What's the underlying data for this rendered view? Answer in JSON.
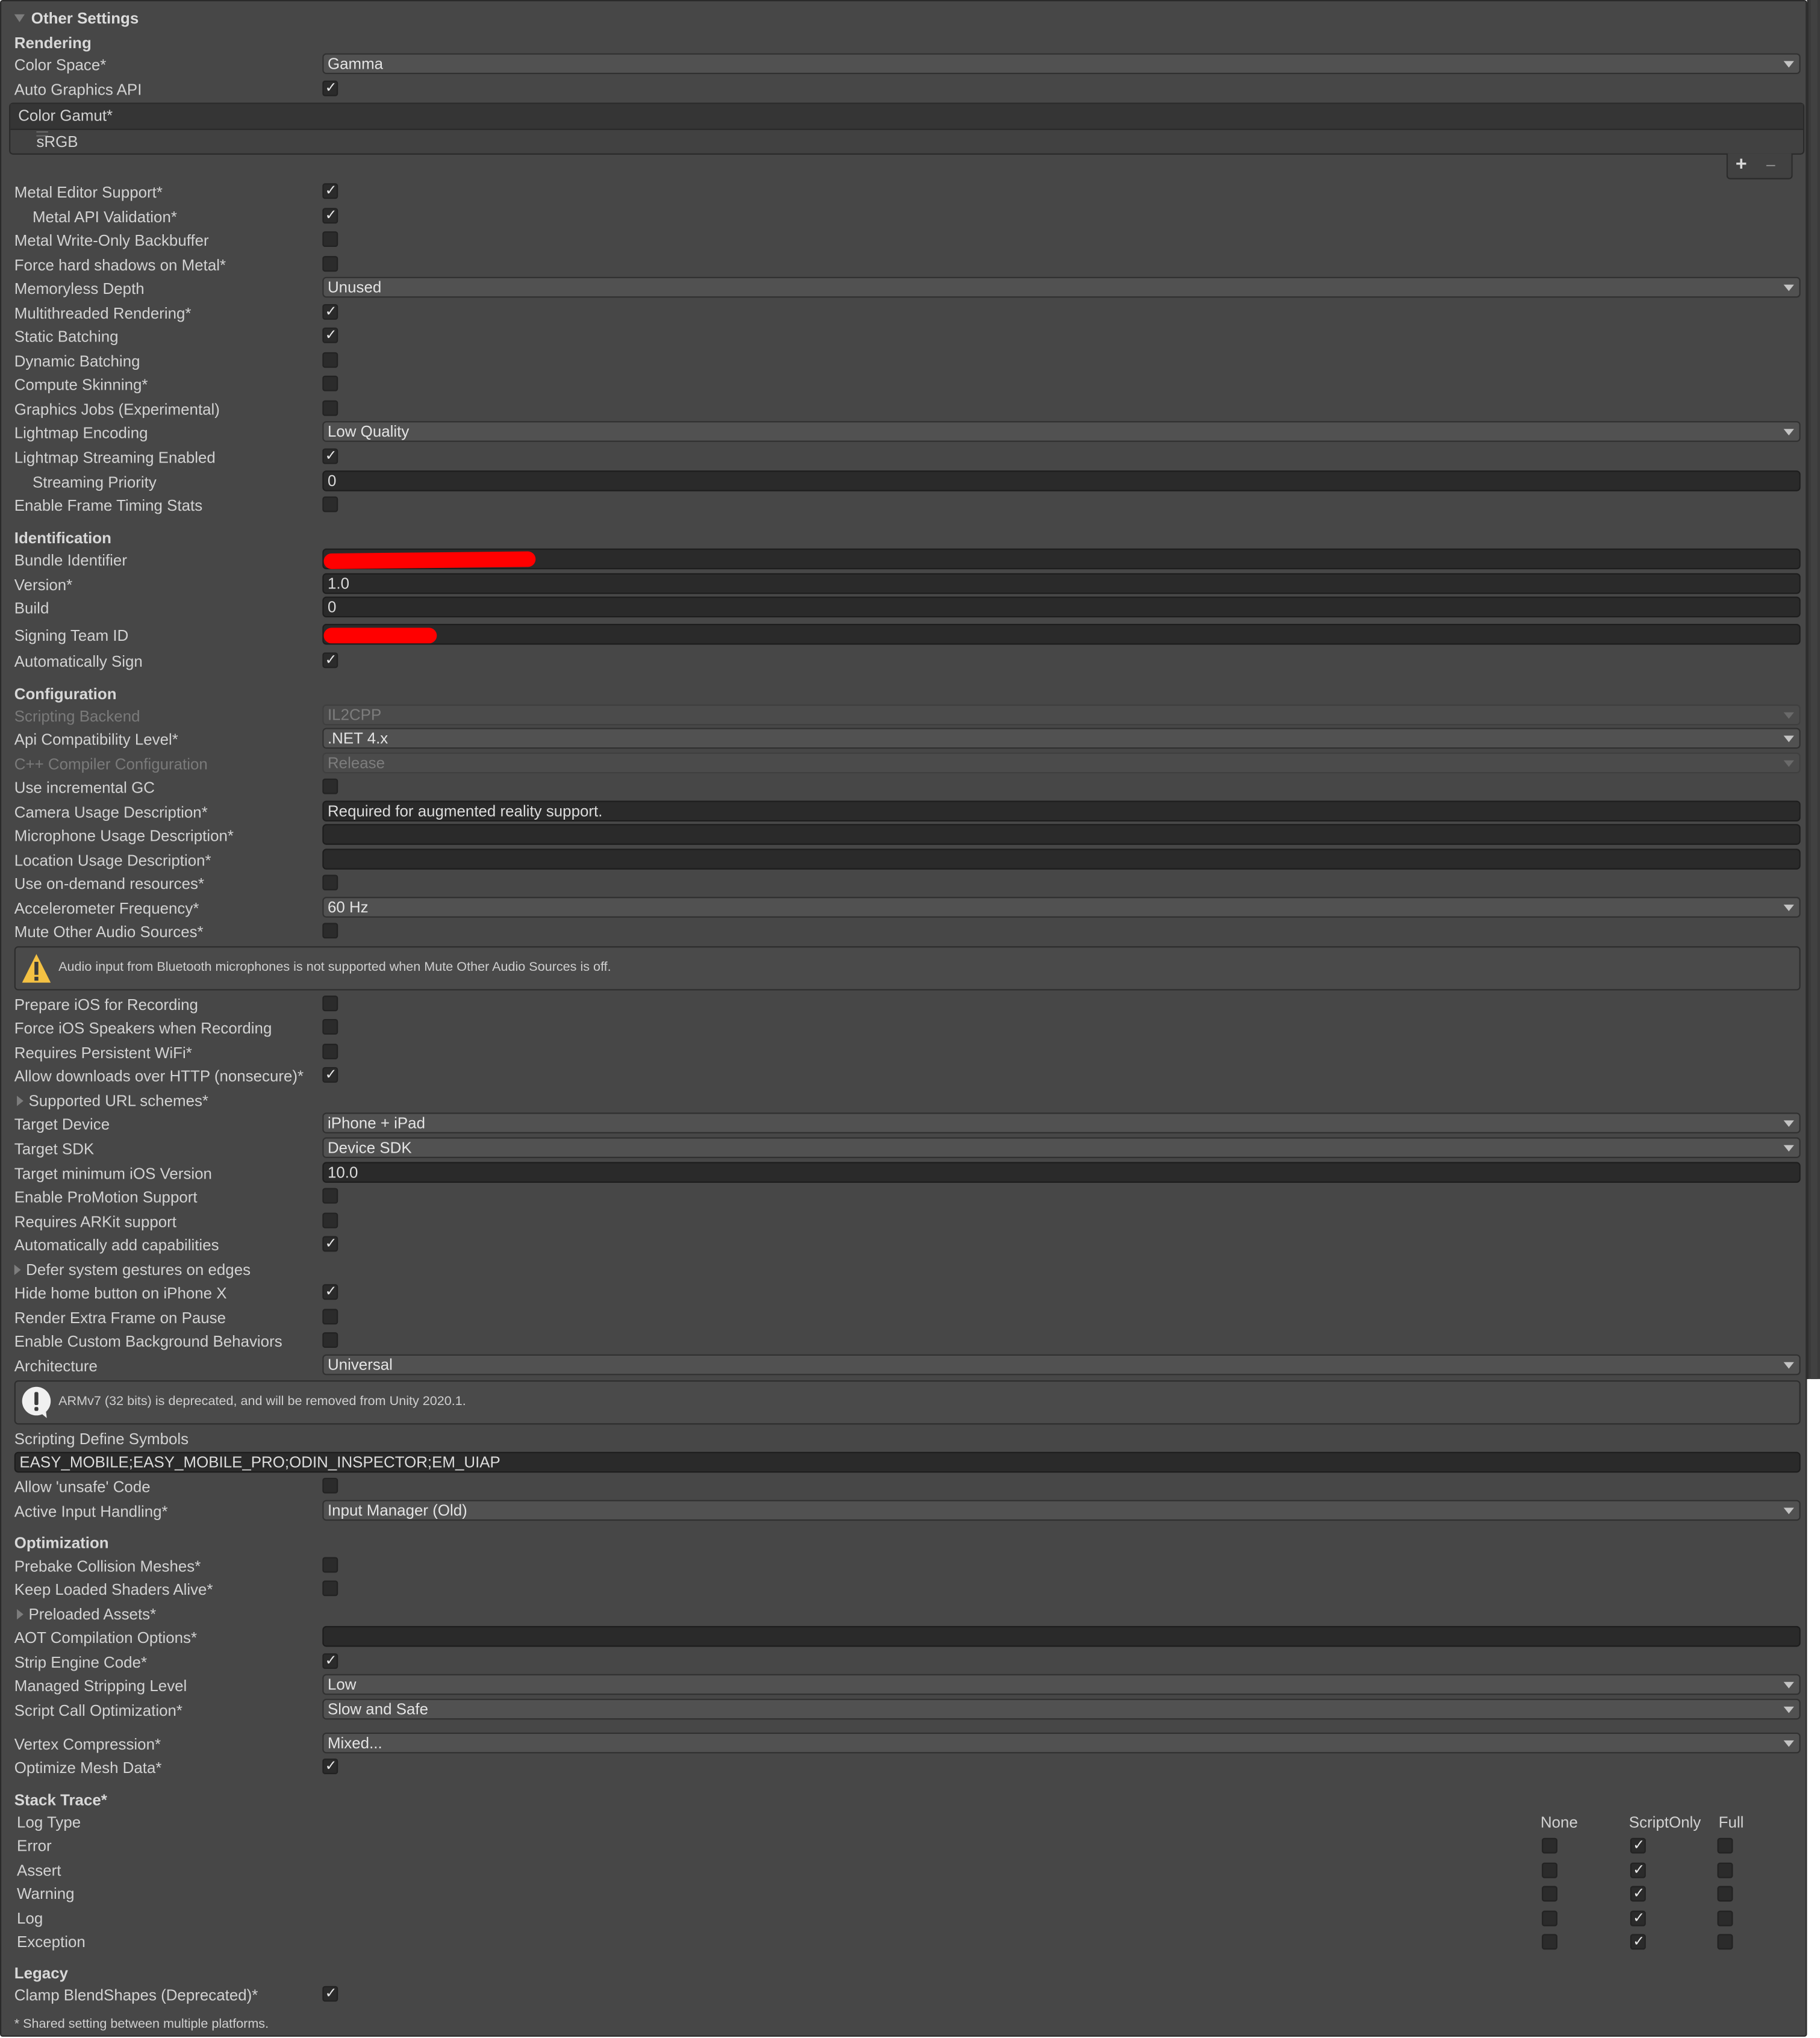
{
  "panel": {
    "title": "Other Settings",
    "footnote": "* Shared setting between multiple platforms."
  },
  "rendering": {
    "heading": "Rendering",
    "color_space": {
      "label": "Color Space*",
      "value": "Gamma"
    },
    "auto_graphics_api": {
      "label": "Auto Graphics API",
      "checked": true
    },
    "color_gamut": {
      "label": "Color Gamut*",
      "items": [
        "sRGB"
      ],
      "add_icon": "plus-icon",
      "remove_icon": "minus-icon"
    },
    "metal_editor_support": {
      "label": "Metal Editor Support*",
      "checked": true
    },
    "metal_api_validation": {
      "label": "Metal API Validation*",
      "checked": true
    },
    "metal_write_only_backbuffer": {
      "label": "Metal Write-Only Backbuffer",
      "checked": false
    },
    "force_hard_shadows": {
      "label": "Force hard shadows on Metal*",
      "checked": false
    },
    "memoryless_depth": {
      "label": "Memoryless Depth",
      "value": "Unused"
    },
    "multithreaded_rendering": {
      "label": "Multithreaded Rendering*",
      "checked": true
    },
    "static_batching": {
      "label": "Static Batching",
      "checked": true
    },
    "dynamic_batching": {
      "label": "Dynamic Batching",
      "checked": false
    },
    "compute_skinning": {
      "label": "Compute Skinning*",
      "checked": false
    },
    "graphics_jobs": {
      "label": "Graphics Jobs (Experimental)",
      "checked": false
    },
    "lightmap_encoding": {
      "label": "Lightmap Encoding",
      "value": "Low Quality"
    },
    "lightmap_streaming": {
      "label": "Lightmap Streaming Enabled",
      "checked": true
    },
    "streaming_priority": {
      "label": "Streaming Priority",
      "value": "0"
    },
    "frame_timing_stats": {
      "label": "Enable Frame Timing Stats",
      "checked": false
    }
  },
  "identification": {
    "heading": "Identification",
    "bundle_identifier": {
      "label": "Bundle Identifier",
      "value": "",
      "redacted": true
    },
    "version": {
      "label": "Version*",
      "value": "1.0"
    },
    "build": {
      "label": "Build",
      "value": "0"
    },
    "signing_team_id": {
      "label": "Signing Team ID",
      "value": "",
      "redacted": true
    },
    "automatically_sign": {
      "label": "Automatically Sign",
      "checked": true
    }
  },
  "configuration": {
    "heading": "Configuration",
    "scripting_backend": {
      "label": "Scripting Backend",
      "value": "IL2CPP",
      "disabled": true
    },
    "api_compat": {
      "label": "Api Compatibility Level*",
      "value": ".NET 4.x"
    },
    "cpp_compiler": {
      "label": "C++ Compiler Configuration",
      "value": "Release",
      "disabled": true
    },
    "incremental_gc": {
      "label": "Use incremental GC",
      "checked": false
    },
    "camera_usage": {
      "label": "Camera Usage Description*",
      "value": "Required for augmented reality support."
    },
    "microphone_usage": {
      "label": "Microphone Usage Description*",
      "value": ""
    },
    "location_usage": {
      "label": "Location Usage Description*",
      "value": ""
    },
    "on_demand_resources": {
      "label": "Use on-demand resources*",
      "checked": false
    },
    "accelerometer_frequency": {
      "label": "Accelerometer Frequency*",
      "value": "60 Hz"
    },
    "mute_other_audio": {
      "label": "Mute Other Audio Sources*",
      "checked": false
    },
    "audio_warning": "Audio input from Bluetooth microphones is not supported when Mute Other Audio Sources is off.",
    "prepare_ios_recording": {
      "label": "Prepare iOS for Recording",
      "checked": false
    },
    "force_ios_speakers": {
      "label": "Force iOS Speakers when Recording",
      "checked": false
    },
    "persistent_wifi": {
      "label": "Requires Persistent WiFi*",
      "checked": false
    },
    "allow_http": {
      "label": "Allow downloads over HTTP (nonsecure)*",
      "checked": true
    },
    "url_schemes": {
      "label": "Supported URL schemes*",
      "expanded": false
    },
    "target_device": {
      "label": "Target Device",
      "value": "iPhone + iPad"
    },
    "target_sdk": {
      "label": "Target SDK",
      "value": "Device SDK"
    },
    "min_ios_version": {
      "label": "Target minimum iOS Version",
      "value": "10.0"
    },
    "promotion_support": {
      "label": "Enable ProMotion Support",
      "checked": false
    },
    "requires_arkit": {
      "label": "Requires ARKit support",
      "checked": false
    },
    "auto_capabilities": {
      "label": "Automatically add capabilities",
      "checked": true
    },
    "defer_gestures": {
      "label": "Defer system gestures on edges",
      "expanded": false
    },
    "hide_home_button": {
      "label": "Hide home button on iPhone X",
      "checked": true
    },
    "render_extra_frame": {
      "label": "Render Extra Frame on Pause",
      "checked": false
    },
    "custom_background": {
      "label": "Enable Custom Background Behaviors",
      "checked": false
    },
    "architecture": {
      "label": "Architecture",
      "value": "Universal"
    },
    "armv7_info": "ARMv7 (32 bits) is deprecated, and will be removed from Unity 2020.1.",
    "define_symbols": {
      "label": "Scripting Define Symbols",
      "value": "EASY_MOBILE;EASY_MOBILE_PRO;ODIN_INSPECTOR;EM_UIAP"
    },
    "allow_unsafe": {
      "label": "Allow 'unsafe' Code",
      "checked": false
    },
    "active_input": {
      "label": "Active Input Handling*",
      "value": "Input Manager (Old)"
    }
  },
  "optimization": {
    "heading": "Optimization",
    "prebake_collision": {
      "label": "Prebake Collision Meshes*",
      "checked": false
    },
    "keep_shaders_alive": {
      "label": "Keep Loaded Shaders Alive*",
      "checked": false
    },
    "preloaded_assets": {
      "label": "Preloaded Assets*",
      "expanded": false
    },
    "aot_options": {
      "label": "AOT Compilation Options*",
      "value": ""
    },
    "strip_engine_code": {
      "label": "Strip Engine Code*",
      "checked": true
    },
    "managed_stripping": {
      "label": "Managed Stripping Level",
      "value": "Low"
    },
    "script_call_opt": {
      "label": "Script Call Optimization*",
      "value": "Slow and Safe"
    },
    "vertex_compression": {
      "label": "Vertex Compression*",
      "value": "Mixed..."
    },
    "optimize_mesh": {
      "label": "Optimize Mesh Data*",
      "checked": true
    }
  },
  "stack_trace": {
    "heading": "Stack Trace*",
    "log_type_label": "Log Type",
    "columns": [
      "None",
      "ScriptOnly",
      "Full"
    ],
    "rows": [
      {
        "type": "Error",
        "none": false,
        "script_only": true,
        "full": false
      },
      {
        "type": "Assert",
        "none": false,
        "script_only": true,
        "full": false
      },
      {
        "type": "Warning",
        "none": false,
        "script_only": true,
        "full": false
      },
      {
        "type": "Log",
        "none": false,
        "script_only": true,
        "full": false
      },
      {
        "type": "Exception",
        "none": false,
        "script_only": true,
        "full": false
      }
    ]
  },
  "legacy": {
    "heading": "Legacy",
    "clamp_blendshapes": {
      "label": "Clamp BlendShapes (Deprecated)*",
      "checked": true
    }
  },
  "glyphs": {
    "check": "✓"
  },
  "colors": {
    "panel_bg": "#474747",
    "field_bg": "#2a2a2a",
    "dropdown_bg": "#515151",
    "redaction": "#ff0000",
    "warning": "#f4c143"
  }
}
